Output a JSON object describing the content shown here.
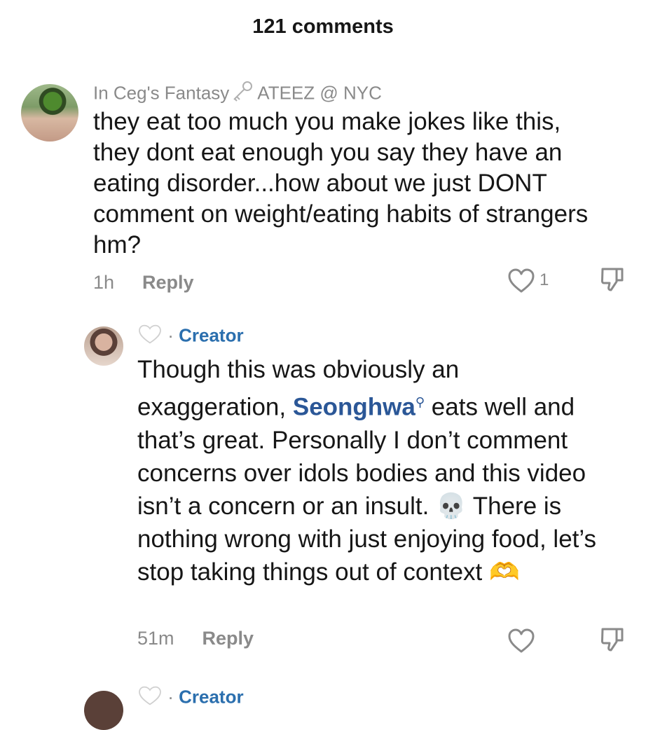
{
  "header": {
    "title": "121 comments"
  },
  "comments": [
    {
      "username": "In Ceg's Fantasy",
      "username_suffix": "ATEEZ @ NYC",
      "text": "they eat too much you make jokes like this, they dont eat enough you say they have an eating disorder...how about we just DONT comment on weight/eating habits of strangers hm?",
      "time": "1h",
      "reply_label": "Reply",
      "like_count": "1",
      "icons": [
        "key-icon",
        "heart-icon",
        "dislike-icon"
      ]
    },
    {
      "creator_label": "Creator",
      "text_part1": "Though this was obviously an exaggeration,",
      "mention": "Seonghwa",
      "text_part2": "eats well and that’s great. Personally I don’t comment concerns over idols bodies and this video isn’t a concern or an insult.",
      "text_part3": "There is nothing wrong with just enjoying food, let’s stop taking things out of context",
      "emoji_skull": "💀",
      "emoji_heart_hands": "🫶",
      "time": "51m",
      "reply_label": "Reply",
      "icons": [
        "white-heart-icon",
        "search-icon",
        "heart-icon",
        "dislike-icon"
      ]
    },
    {
      "creator_label": "Creator"
    }
  ],
  "colors": {
    "accent": "#2b5797",
    "muted": "#8a8a8a",
    "text": "#161616"
  }
}
